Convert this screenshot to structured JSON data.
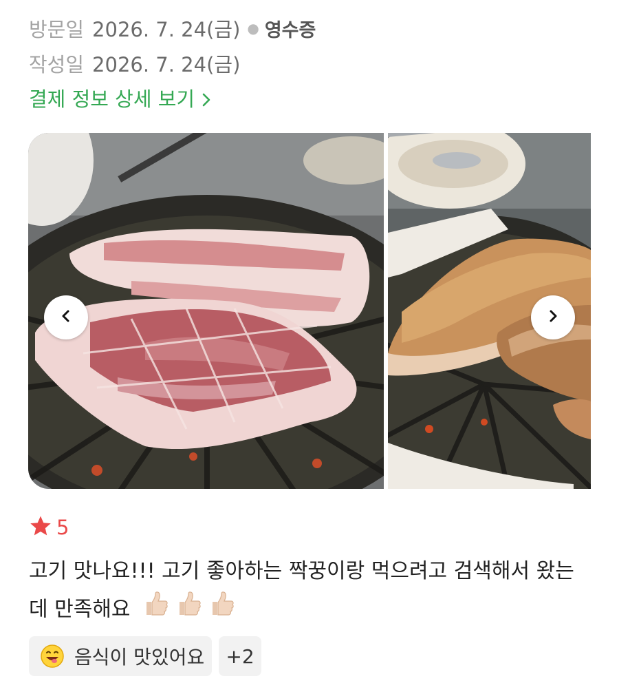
{
  "visit": {
    "label": "방문일",
    "date": "2026. 7. 24(금)",
    "receipt_label": "영수증"
  },
  "written": {
    "label": "작성일",
    "date": "2026. 7. 24(금)"
  },
  "payment_link": {
    "label": "결제 정보 상세 보기"
  },
  "gallery": {
    "photos": [
      {
        "icon": "grilled-pork-belly-raw-photo"
      },
      {
        "icon": "grilled-pork-belly-cooked-photo"
      }
    ],
    "prev_icon": "chevron-left-icon",
    "next_icon": "chevron-right-icon"
  },
  "rating": {
    "icon": "star-icon",
    "score": "5",
    "color": "#ea4949"
  },
  "review": {
    "text": "고기 맛나요!!! 고기 좋아하는 짝꿍이랑 먹으려고 검색해서 왔는데 만족해요",
    "thumbs_icon": "thumbs-up-icon",
    "thumbs_count": 3
  },
  "tags": {
    "primary": {
      "icon": "smiling-face-icon",
      "label": "음식이 맛있어요"
    },
    "more_count": "+2"
  },
  "colors": {
    "link_green": "#34a853",
    "tag_bg": "#f2f2f2"
  }
}
